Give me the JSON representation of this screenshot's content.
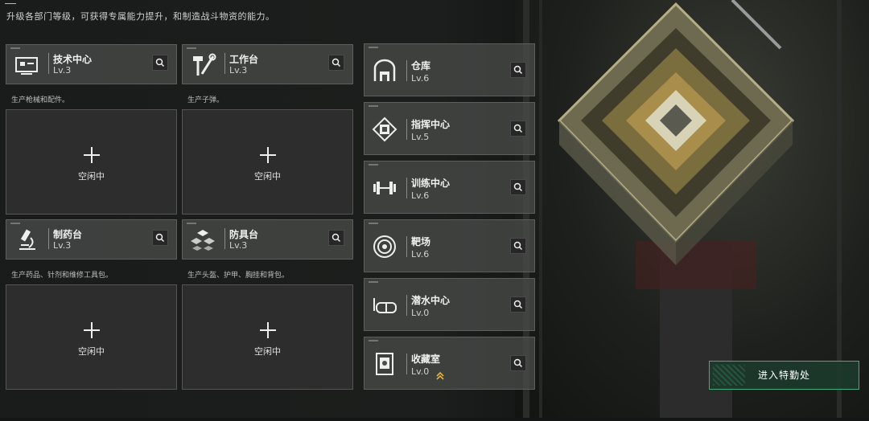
{
  "subtitle": "升级各部门等级，可获得专属能力提升，和制造战斗物资的能力。",
  "production_departments": [
    {
      "name": "技术中心",
      "level": "Lv.3",
      "icon": "computer-monitor-icon",
      "description": "生产枪械和配件。",
      "slot_status": "空闲中"
    },
    {
      "name": "工作台",
      "level": "Lv.3",
      "icon": "hammer-wrench-icon",
      "description": "生产子弹。",
      "slot_status": "空闲中"
    },
    {
      "name": "制药台",
      "level": "Lv.3",
      "icon": "microscope-icon",
      "description": "生产药品、针剂和维修工具包。",
      "slot_status": "空闲中"
    },
    {
      "name": "防具台",
      "level": "Lv.3",
      "icon": "armor-blocks-icon",
      "description": "生产头盔、护甲、胸挂和背包。",
      "slot_status": "空闲中"
    }
  ],
  "facilities": [
    {
      "name": "仓库",
      "level": "Lv.6",
      "icon": "warehouse-icon"
    },
    {
      "name": "指挥中心",
      "level": "Lv.5",
      "icon": "chip-icon"
    },
    {
      "name": "训练中心",
      "level": "Lv.6",
      "icon": "dumbbell-icon"
    },
    {
      "name": "靶场",
      "level": "Lv.6",
      "icon": "target-icon"
    },
    {
      "name": "潜水中心",
      "level": "Lv.0",
      "icon": "diving-mask-icon"
    },
    {
      "name": "收藏室",
      "level": "Lv.0",
      "icon": "collection-case-icon",
      "upgrade_indicator": "double-chevron-up-icon"
    }
  ],
  "enter_button_label": "进入特勤处",
  "colors": {
    "accent_green": "#3fae7a",
    "upgrade_yellow": "#e6b23a"
  }
}
